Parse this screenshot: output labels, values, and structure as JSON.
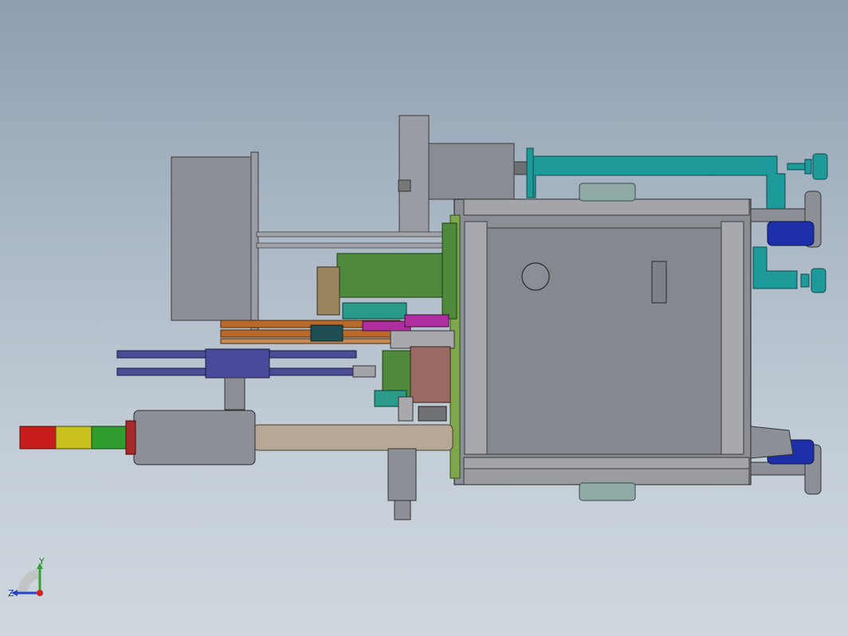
{
  "triad": {
    "x_label": "",
    "y_label": "Y",
    "z_label": "Z",
    "axis_y_color": "#2fa52f",
    "axis_z_color": "#2844c8",
    "axis_x_color": "#d02020"
  },
  "colors": {
    "background_top": "#8e9db0",
    "background_bottom": "#cfd7de",
    "frame_grey": "#8d8f96",
    "teal_bracket": "#1f9a9a",
    "green_block": "#4f8a3c",
    "orange_rail": "#b9692a",
    "purple_belt": "#4c4c96",
    "tan_tube": "#b7a796",
    "light_red": "#c81d1d",
    "light_yellow": "#c8c01f",
    "light_green": "#2f9e2f",
    "blue_foot": "#1c2fa8"
  }
}
